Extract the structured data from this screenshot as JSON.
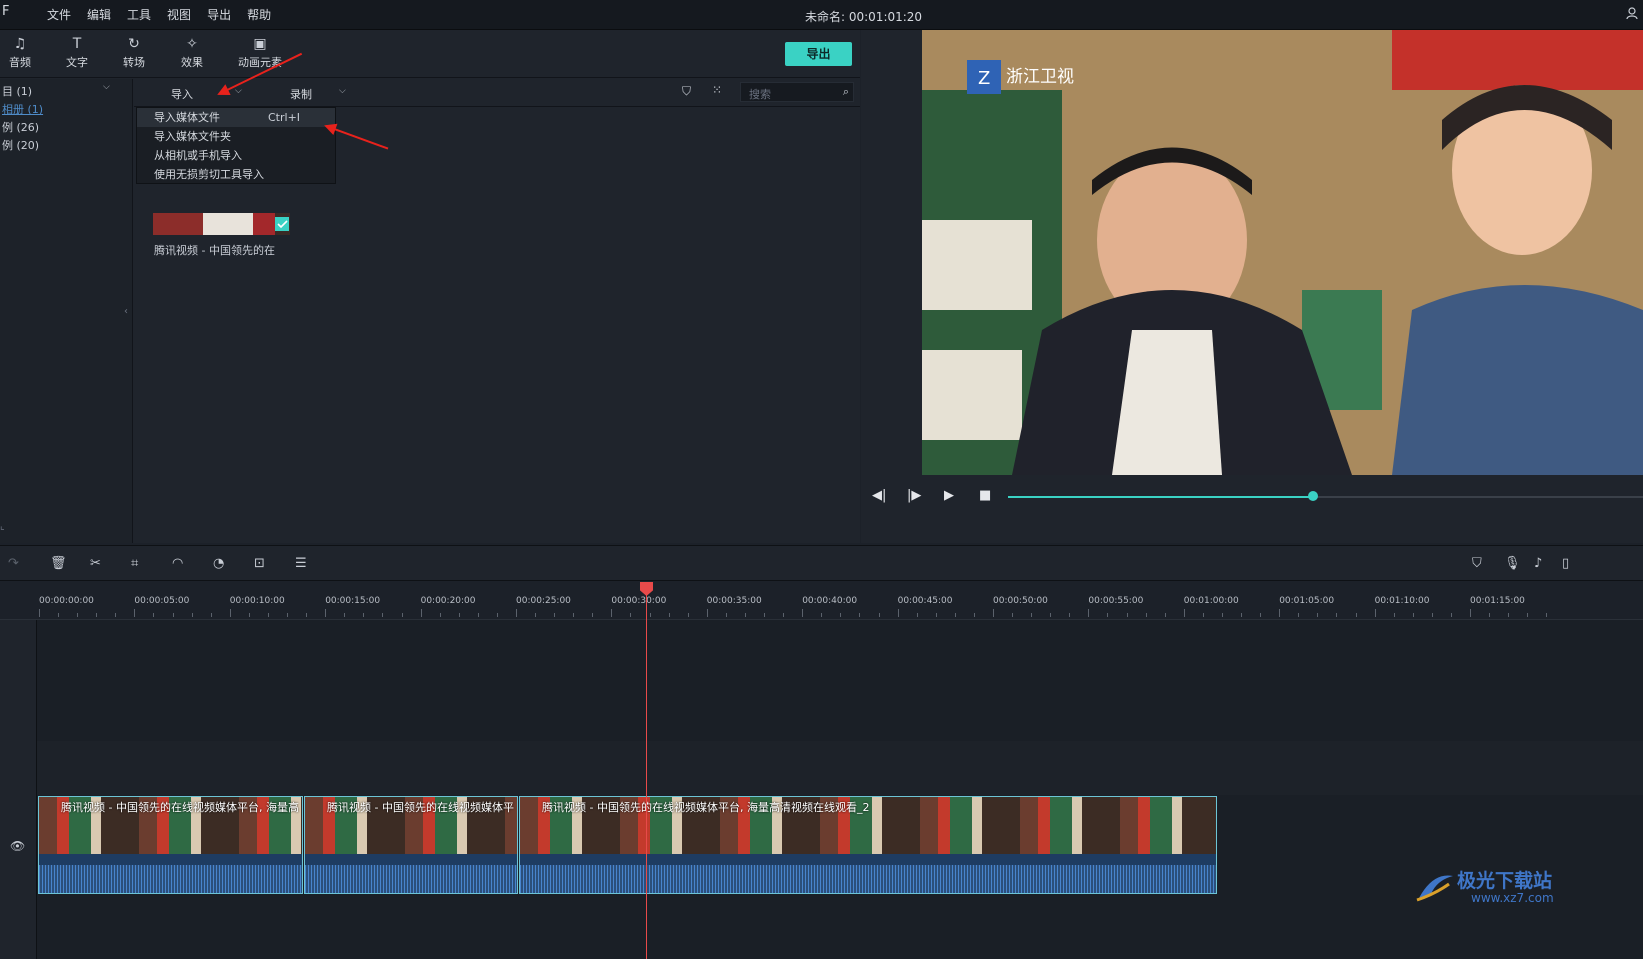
{
  "menubar": {
    "logo": "F",
    "items": [
      "文件",
      "编辑",
      "工具",
      "视图",
      "导出",
      "帮助"
    ],
    "project_title": "未命名: 00:01:01:20"
  },
  "toolbar": {
    "tools": [
      {
        "icon": "music-note-icon",
        "label": "音频"
      },
      {
        "icon": "text-icon",
        "label": "文字"
      },
      {
        "icon": "transition-icon",
        "label": "转场"
      },
      {
        "icon": "effects-icon",
        "label": "效果"
      },
      {
        "icon": "image-icon",
        "label": "动画元素"
      }
    ],
    "export_label": "导出"
  },
  "left_tree": {
    "rows": [
      "目 (1)",
      "相册 (1)",
      "例 (26)",
      "例 (20)"
    ]
  },
  "subbar": {
    "import_label": "导入",
    "record_label": "录制",
    "search_placeholder": "搜索"
  },
  "import_menu": {
    "items": [
      {
        "label": "导入媒体文件",
        "shortcut": "Ctrl+I"
      },
      {
        "label": "导入媒体文件夹",
        "shortcut": ""
      },
      {
        "label": "从相机或手机导入",
        "shortcut": ""
      },
      {
        "label": "使用无损剪切工具导入",
        "shortcut": ""
      }
    ]
  },
  "media": {
    "thumb_label": "腾讯视频 - 中国领先的在"
  },
  "preview": {
    "channel_logo": "浙江卫视",
    "progress": 0.48,
    "colors": {
      "accent": "#3ad2c4"
    }
  },
  "timeline": {
    "ticks": [
      "00:00:00:00",
      "00:00:05:00",
      "00:00:10:00",
      "00:00:15:00",
      "00:00:20:00",
      "00:00:25:00",
      "00:00:30:00",
      "00:00:35:00",
      "00:00:40:00",
      "00:00:45:00",
      "00:00:50:00",
      "00:00:55:00",
      "00:01:00:00",
      "00:01:05:00",
      "00:01:10:00",
      "00:01:15:00"
    ],
    "clips": [
      {
        "label": "腾讯视频 - 中国领先的在线视频媒体平台, 海量高"
      },
      {
        "label": "腾讯视频 - 中国领先的在线视频媒体平"
      },
      {
        "label": "腾讯视频 - 中国领先的在线视频媒体平台, 海量高清视频在线观看_2"
      }
    ],
    "playhead_color": "#e84a4a"
  },
  "watermark": {
    "title": "极光下载站",
    "url": "www.xz7.com"
  }
}
